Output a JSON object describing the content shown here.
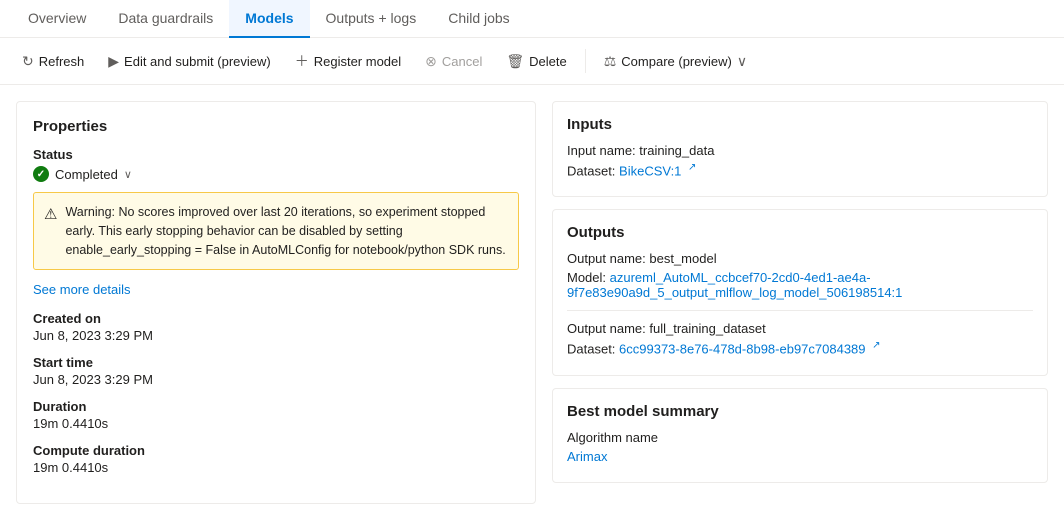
{
  "tabs": [
    {
      "id": "overview",
      "label": "Overview",
      "active": false
    },
    {
      "id": "data-guardrails",
      "label": "Data guardrails",
      "active": false
    },
    {
      "id": "models",
      "label": "Models",
      "active": true
    },
    {
      "id": "outputs-logs",
      "label": "Outputs + logs",
      "active": false
    },
    {
      "id": "child-jobs",
      "label": "Child jobs",
      "active": false
    }
  ],
  "toolbar": {
    "refresh": "Refresh",
    "edit_submit": "Edit and submit (preview)",
    "register_model": "Register model",
    "cancel": "Cancel",
    "delete": "Delete",
    "compare": "Compare (preview)"
  },
  "properties": {
    "title": "Properties",
    "status_label": "Status",
    "status_value": "Completed",
    "warning_text": "Warning: No scores improved over last 20 iterations, so experiment stopped early. This early stopping behavior can be disabled by setting enable_early_stopping = False in AutoMLConfig for notebook/python SDK runs.",
    "see_more": "See more details",
    "created_on_label": "Created on",
    "created_on_value": "Jun 8, 2023 3:29 PM",
    "start_time_label": "Start time",
    "start_time_value": "Jun 8, 2023 3:29 PM",
    "duration_label": "Duration",
    "duration_value": "19m 0.4410s",
    "compute_duration_label": "Compute duration",
    "compute_duration_value": "19m 0.4410s"
  },
  "inputs": {
    "title": "Inputs",
    "input_name_label": "Input name: training_data",
    "dataset_label": "Dataset:",
    "dataset_link": "BikeCSV:1"
  },
  "outputs": {
    "title": "Outputs",
    "output_name_1": "Output name: best_model",
    "model_label": "Model:",
    "model_link": "azureml_AutoML_ccbcef70-2cd0-4ed1-ae4a-9f7e83e90a9d_5_output_mlflow_log_model_506198514:1",
    "output_name_2": "Output name: full_training_dataset",
    "dataset_label": "Dataset:",
    "dataset_link_2": "6cc99373-8e76-478d-8b98-eb97c7084389"
  },
  "best_model": {
    "title": "Best model summary",
    "algorithm_label": "Algorithm name",
    "algorithm_value": "Arimax"
  }
}
